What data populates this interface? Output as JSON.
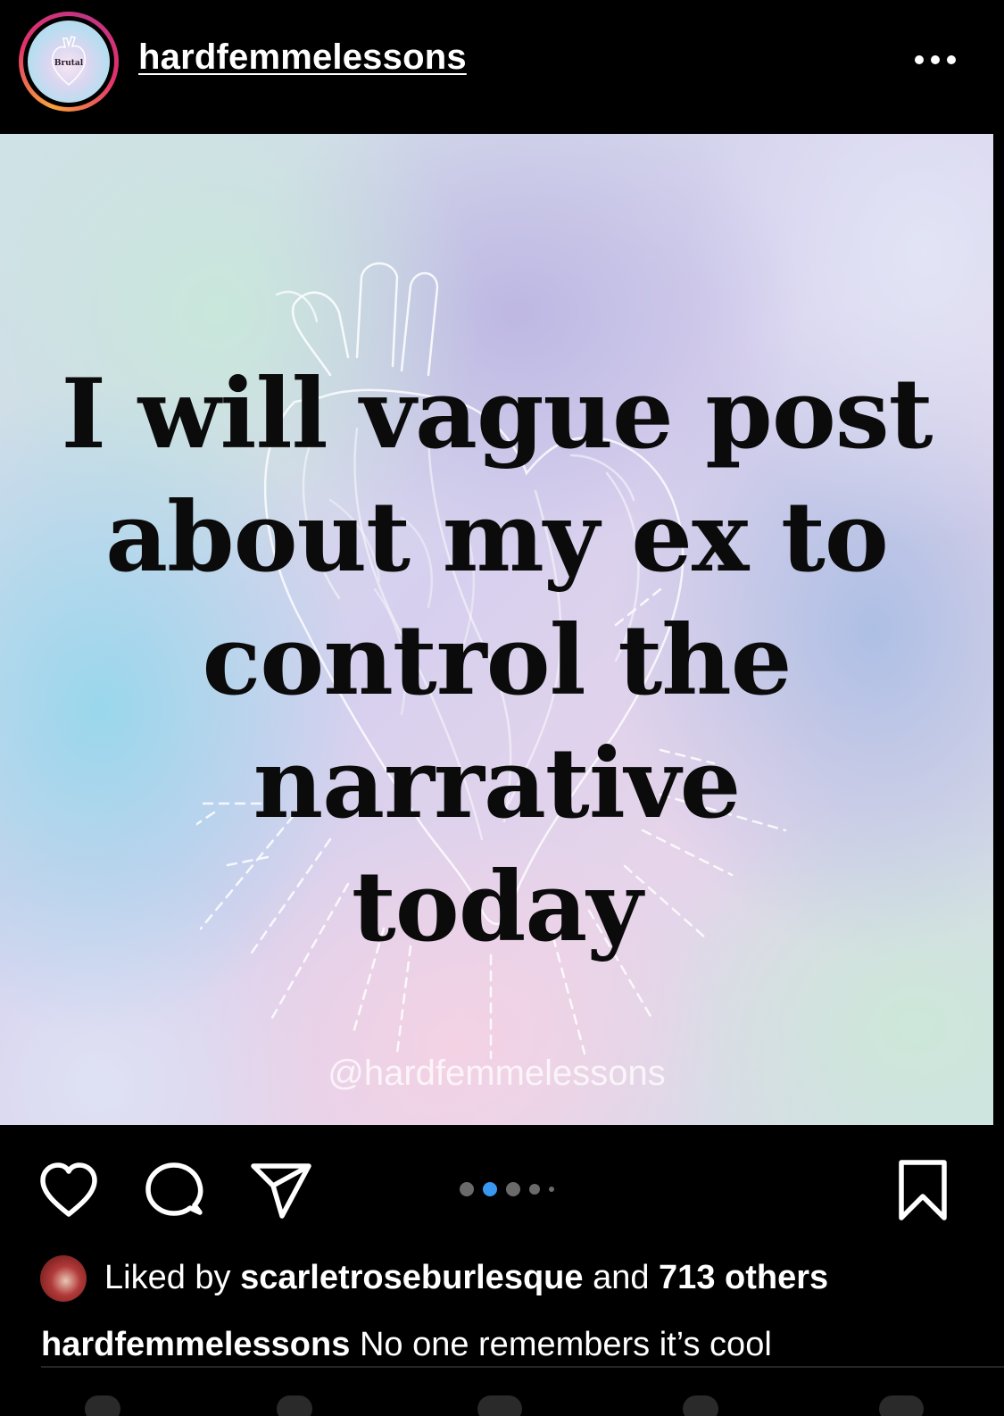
{
  "header": {
    "username": "hardfemmelessons",
    "avatar_text": "Brutal",
    "more_icon": "more-horizontal-icon"
  },
  "post": {
    "quote_lines": [
      "I will vague post",
      "about my ex to",
      "control the narrative",
      "today"
    ],
    "watermark": "@hardfemmelessons",
    "carousel_total": 5,
    "carousel_active_index": 1
  },
  "actions": {
    "like_icon": "heart-icon",
    "comment_icon": "comment-icon",
    "share_icon": "paper-plane-icon",
    "save_icon": "bookmark-icon"
  },
  "likes": {
    "prefix": "Liked by",
    "liker": "scarletroseburlesque",
    "connector": "and",
    "others": "713 others"
  },
  "caption": {
    "username": "hardfemmelessons",
    "text": "No one remembers it’s cool"
  },
  "colors": {
    "background": "#000000",
    "text": "#ffffff",
    "active_dot": "#3897f0",
    "inactive_dot": "#6a6a6a",
    "quote_text": "#0b0b0b"
  }
}
